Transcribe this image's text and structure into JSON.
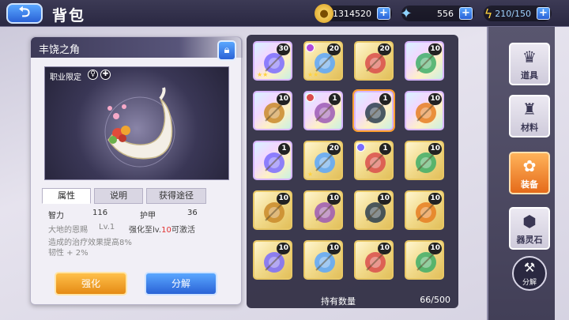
{
  "header": {
    "title": "背包",
    "back_icon": "back-arrow-icon"
  },
  "currencies": [
    {
      "icon": "gold-coin-icon",
      "value": "1314520"
    },
    {
      "icon": "star-gem-icon",
      "value": "556"
    },
    {
      "icon": "lightning-icon",
      "value": "210/150"
    }
  ],
  "item": {
    "name": "丰饶之角",
    "restriction_label": "职业限定",
    "tabs": [
      "属性",
      "说明",
      "获得途径"
    ],
    "stats": {
      "int_label": "智力",
      "int_value": "116",
      "armor_label": "护甲",
      "armor_value": "36",
      "bond_name": "大地的恩赐",
      "bond_level": "Lv.1",
      "unlock_prefix": "强化至lv.",
      "unlock_level": "10",
      "unlock_suffix": "可激活",
      "effect_1": "造成的治疗效果提高8%",
      "effect_2": "韧性 + 2%"
    },
    "enhance_label": "强化",
    "decompose_label": "分解"
  },
  "inventory": {
    "capacity_label": "持有数量",
    "capacity_value": "66/500",
    "items": [
      {
        "name": "grail-chalice",
        "count": "30",
        "rainbow": true,
        "stars": "★★"
      },
      {
        "name": "scepter",
        "count": "20",
        "rainbow": false,
        "stars": "★★"
      },
      {
        "name": "golden-helmet",
        "count": "20",
        "rainbow": false,
        "stars": ""
      },
      {
        "name": "owl-pet",
        "count": "10",
        "rainbow": true,
        "stars": ""
      },
      {
        "name": "winged-helm",
        "count": "10",
        "rainbow": true,
        "stars": ""
      },
      {
        "name": "crystal-staff",
        "count": "1",
        "rainbow": true,
        "stars": ""
      },
      {
        "name": "horn-of-plenty",
        "count": "1",
        "rainbow": true,
        "stars": "",
        "selected": true
      },
      {
        "name": "winged-helm-2",
        "count": "10",
        "rainbow": true,
        "stars": ""
      },
      {
        "name": "battle-axe",
        "count": "1",
        "rainbow": true,
        "stars": ""
      },
      {
        "name": "long-sword",
        "count": "20",
        "rainbow": false,
        "stars": "★"
      },
      {
        "name": "spear",
        "count": "1",
        "rainbow": false,
        "stars": ""
      },
      {
        "name": "chest-armor",
        "count": "10",
        "rainbow": false,
        "stars": ""
      },
      {
        "name": "dark-armor",
        "count": "10",
        "rainbow": false,
        "stars": ""
      },
      {
        "name": "arrows",
        "count": "10",
        "rainbow": false,
        "stars": ""
      },
      {
        "name": "wand",
        "count": "10",
        "rainbow": false,
        "stars": ""
      },
      {
        "name": "treasure-box",
        "count": "10",
        "rainbow": false,
        "stars": ""
      },
      {
        "name": "round-shield",
        "count": "10",
        "rainbow": false,
        "stars": ""
      },
      {
        "name": "ornate-shield",
        "count": "10",
        "rainbow": false,
        "stars": ""
      },
      {
        "name": "knight-helm",
        "count": "10",
        "rainbow": false,
        "stars": ""
      },
      {
        "name": "red-helm",
        "count": "10",
        "rainbow": false,
        "stars": ""
      }
    ]
  },
  "sidebar": {
    "items": [
      {
        "label": "道具",
        "icon": "crown-icon"
      },
      {
        "label": "材料",
        "icon": "castle-icon"
      },
      {
        "label": "装备",
        "icon": "flower-icon"
      },
      {
        "label": "器灵石",
        "icon": "spirit-stone-icon"
      }
    ],
    "decompose_label": "分解",
    "decompose_icon": "hammer-icon"
  }
}
